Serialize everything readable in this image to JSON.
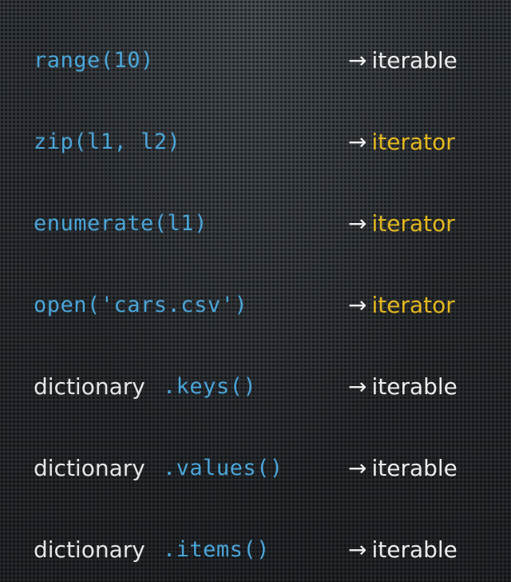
{
  "colors": {
    "code": "#4aa6da",
    "plain_text": "#e6e6e6",
    "iterable": "#ececec",
    "iterator": "#e3b71f"
  },
  "arrow": "→",
  "rows": [
    {
      "prefix": "",
      "code": "range(10)",
      "kind": "iterable"
    },
    {
      "prefix": "",
      "code": "zip(l1, l2)",
      "kind": "iterator"
    },
    {
      "prefix": "",
      "code": "enumerate(l1)",
      "kind": "iterator"
    },
    {
      "prefix": "",
      "code": "open('cars.csv')",
      "kind": "iterator"
    },
    {
      "prefix": "dictionary",
      "code": ".keys()",
      "kind": "iterable"
    },
    {
      "prefix": "dictionary",
      "code": ".values()",
      "kind": "iterable"
    },
    {
      "prefix": "dictionary",
      "code": ".items()",
      "kind": "iterable"
    }
  ]
}
